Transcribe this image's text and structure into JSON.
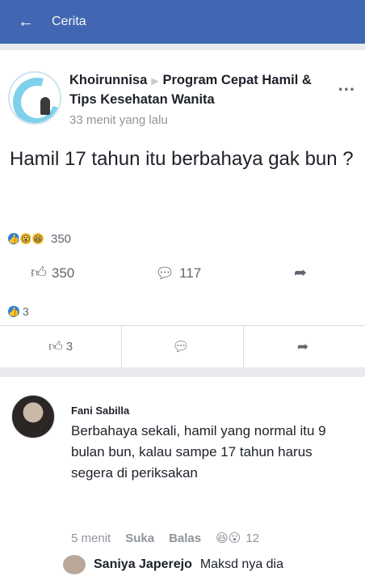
{
  "topbar": {
    "back_glyph": "←",
    "title": "Cerita"
  },
  "post": {
    "author": "Khoirunnisa",
    "group": "Program Cepat Hamil & Tips Kesehatan Wanita",
    "time": "33 menit yang lalu",
    "more_glyph": "...",
    "text": "Hamil 17 tahun itu berbahaya gak bun ?",
    "reaction_count": "350",
    "like_count": "350",
    "comment_count": "117",
    "reaction_count_2": "3",
    "button_like_count": "3"
  },
  "comment": {
    "author": "Fani Sabilla",
    "text": "Berbahaya sekali, hamil yang normal itu 9 bulan bun, kalau sampe 17 tahun harus segera di periksakan",
    "time": "5 menit",
    "like_label": "Suka",
    "reply_label": "Balas",
    "reaction_count": "12"
  },
  "reply": {
    "author": "Saniya Japerejo",
    "text": "Maksd nya dia"
  },
  "icons": {
    "back": "arrow-left-icon",
    "like": "thumb-up-icon",
    "comment": "speech-bubble-icon",
    "share": "share-arrow-icon",
    "more": "more-dots-icon"
  }
}
